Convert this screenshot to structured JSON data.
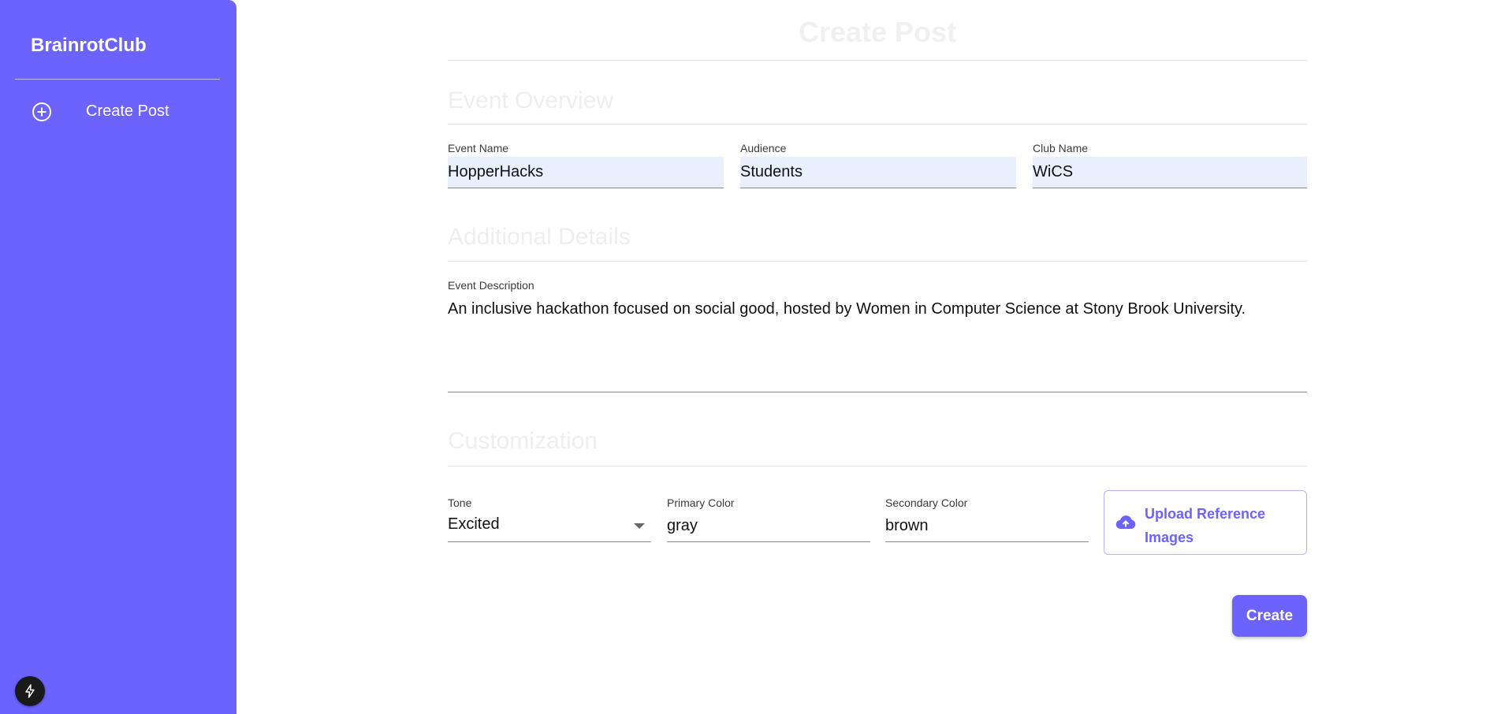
{
  "sidebar": {
    "brand": "BrainrotClub",
    "items": [
      {
        "label": "Create Post",
        "icon": "plus-circle-icon"
      }
    ],
    "bottom_icon": "bolt-icon"
  },
  "main": {
    "title": "Create Post",
    "sections": {
      "overview": "Event Overview",
      "details": "Additional Details",
      "customization": "Customization"
    },
    "fields": {
      "event_name": {
        "label": "Event Name",
        "value": "HopperHacks"
      },
      "audience": {
        "label": "Audience",
        "value": "Students"
      },
      "club_name": {
        "label": "Club Name",
        "value": "WiCS"
      },
      "event_description": {
        "label": "Event Description",
        "value": "An inclusive hackathon focused on social good, hosted by Women in Computer Science at Stony Brook University."
      },
      "tone": {
        "label": "Tone",
        "value": "Excited"
      },
      "primary_color": {
        "label": "Primary Color",
        "value": "gray"
      },
      "secondary_color": {
        "label": "Secondary Color",
        "value": "brown"
      }
    },
    "upload_label": "Upload Reference Images",
    "create_label": "Create"
  },
  "colors": {
    "accent": "#6c63ff",
    "input_fill": "#e8f0fe"
  }
}
